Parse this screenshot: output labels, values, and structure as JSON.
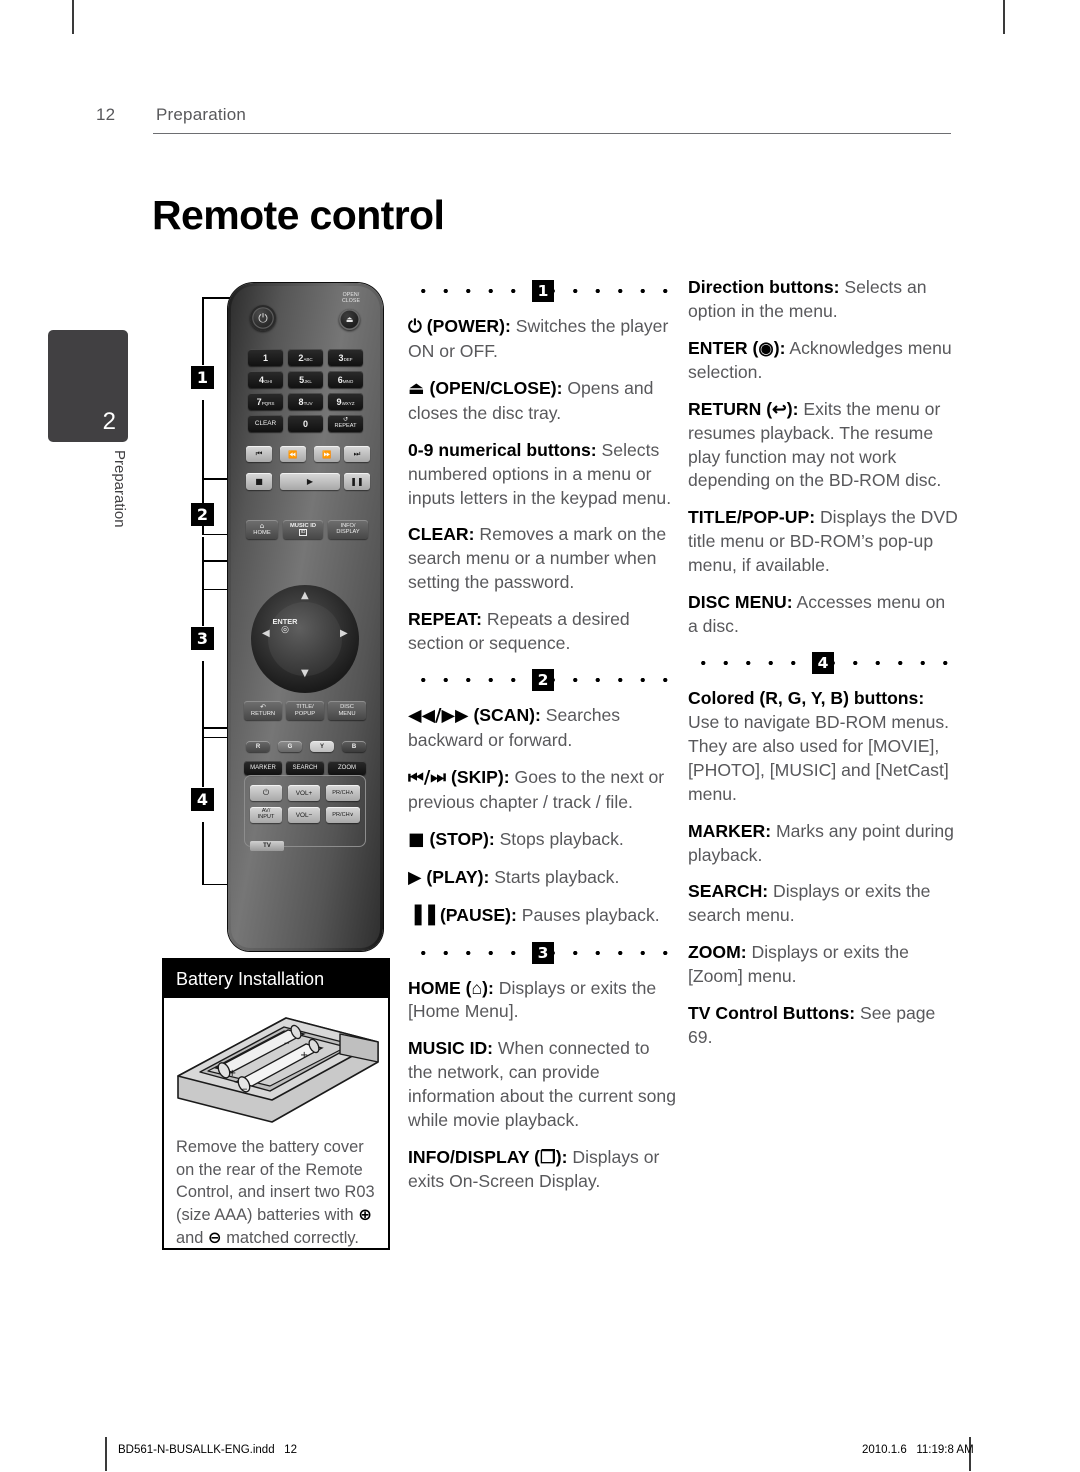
{
  "header": {
    "page_number": "12",
    "section": "Preparation"
  },
  "section_title": "Remote control",
  "side_tab": {
    "number": "2",
    "label": "Preparation"
  },
  "callout_badges": [
    "1",
    "2",
    "3",
    "4"
  ],
  "remote": {
    "power_icon": "power-icon",
    "open_close_label": "OPEN/\nCLOSE",
    "eject_icon": "eject-icon",
    "numeric_keys": [
      {
        "digit": "1",
        "letters": ""
      },
      {
        "digit": "2",
        "letters": "ABC"
      },
      {
        "digit": "3",
        "letters": "DEF"
      },
      {
        "digit": "4",
        "letters": "GHI"
      },
      {
        "digit": "5",
        "letters": "JKL"
      },
      {
        "digit": "6",
        "letters": "MNO"
      },
      {
        "digit": "7",
        "letters": "PQRS"
      },
      {
        "digit": "8",
        "letters": "TUV"
      },
      {
        "digit": "9",
        "letters": "WXYZ"
      }
    ],
    "clear_key": "CLEAR",
    "zero_key": "0",
    "repeat_key": "REPEAT",
    "transport_keys": [
      "⏮",
      "⏪",
      "⏩",
      "⏭"
    ],
    "playback_keys": [
      "■",
      "▶",
      "▐▐"
    ],
    "home_key": "HOME",
    "music_id_key": "MUSIC ID",
    "music_id_badge": "ID",
    "info_display_key": "INFO/\nDISPLAY",
    "enter_key": "ENTER",
    "return_key": "RETURN",
    "title_popup_key": "TITLE/\nPOPUP",
    "disc_menu_key": "DISC\nMENU",
    "color_keys": [
      "R",
      "G",
      "Y",
      "B"
    ],
    "marker_key": "MARKER",
    "search_key": "SEARCH",
    "zoom_key": "ZOOM",
    "tv_keys": [
      "⏻",
      "VOL+",
      "PR/CH∧",
      "AV/\nINPUT",
      "VOL−",
      "PR/CH∨"
    ],
    "tv_label": "TV"
  },
  "battery": {
    "title": "Battery Installation",
    "text_parts": {
      "a": "Remove the battery cover on the rear of the Remote Control, and insert two R03 (size AAA) batteries with ",
      "plus": "⊕",
      "b": " and ",
      "minus": "⊖",
      "c": " matched correctly."
    }
  },
  "middle_column": {
    "group1": {
      "badge": "1",
      "items": [
        {
          "glyph": "⏻",
          "term": " (POWER):",
          "desc": " Switches the player ON or OFF."
        },
        {
          "glyph": "⏏",
          "term": " (OPEN/CLOSE):",
          "desc": " Opens and closes the disc tray."
        },
        {
          "glyph": "",
          "term": "0-9 numerical buttons:",
          "desc": " Selects numbered options in a menu or inputs letters in the keypad menu."
        },
        {
          "glyph": "",
          "term": "CLEAR:",
          "desc": " Removes a mark on the search menu or a number when setting the password."
        },
        {
          "glyph": "",
          "term": "REPEAT:",
          "desc": " Repeats a desired section or sequence."
        }
      ]
    },
    "group2": {
      "badge": "2",
      "items": [
        {
          "glyph": "◀◀/▶▶",
          "term": " (SCAN):",
          "desc": " Searches backward or forward."
        },
        {
          "glyph": "⏮/⏭",
          "term": " (SKIP):",
          "desc": " Goes to the next or previous chapter / track / file."
        },
        {
          "glyph": "■",
          "term": " (STOP):",
          "desc": " Stops playback."
        },
        {
          "glyph": "▶",
          "term": " (PLAY):",
          "desc": " Starts playback."
        },
        {
          "glyph": "▐▐",
          "term": " (PAUSE):",
          "desc": " Pauses playback."
        }
      ]
    },
    "group3": {
      "badge": "3",
      "items": [
        {
          "glyph": "",
          "term": "HOME (⌂):",
          "desc": " Displays or exits the [Home Menu]."
        },
        {
          "glyph": "",
          "term": "MUSIC ID:",
          "desc": " When connected to the network, can provide information about the current song while movie playback."
        },
        {
          "glyph": "",
          "term": "INFO/DISPLAY (❐):",
          "desc": " Displays or exits On-Screen Display."
        }
      ]
    }
  },
  "right_column": {
    "group_top": {
      "items": [
        {
          "term": "Direction buttons:",
          "desc": " Selects an option in the menu."
        },
        {
          "term": "ENTER (◉):",
          "desc": " Acknowledges menu selection."
        },
        {
          "term": "RETURN (↩):",
          "desc": " Exits the menu or resumes playback. The resume play function may not work depending on the BD-ROM disc."
        },
        {
          "term": "TITLE/POP-UP:",
          "desc": " Displays the DVD title menu or BD-ROM’s pop-up menu, if available."
        },
        {
          "term": "DISC MENU:",
          "desc": " Accesses menu on a disc."
        }
      ]
    },
    "group4": {
      "badge": "4",
      "items": [
        {
          "term": "Colored (R, G, Y, B) buttons:",
          "desc": " Use to navigate BD-ROM menus. They are also used for [MOVIE], [PHOTO], [MUSIC] and [NetCast] menu."
        },
        {
          "term": "MARKER:",
          "desc": " Marks any point during playback."
        },
        {
          "term": "SEARCH:",
          "desc": " Displays or exits the search menu."
        },
        {
          "term": "ZOOM:",
          "desc": " Displays or exits the [Zoom] menu."
        },
        {
          "term": "TV Control Buttons:",
          "desc": " See page 69."
        }
      ]
    }
  },
  "footer": {
    "left": "BD561-N-BUSALLK-ENG.indd   12",
    "right": "2010.1.6   11:19:8 AM"
  }
}
